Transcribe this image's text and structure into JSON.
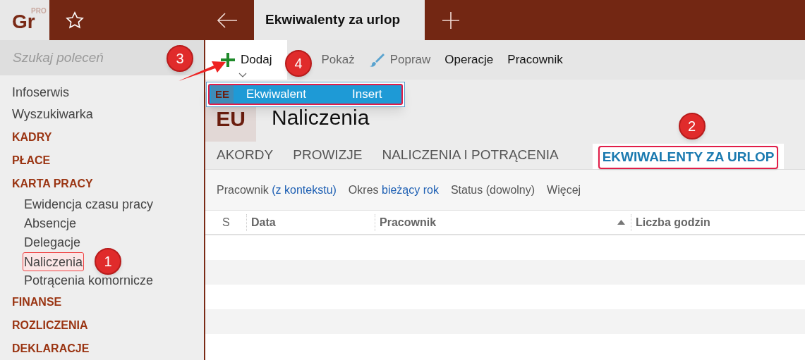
{
  "logo": {
    "text": "Gr",
    "badge": "PRO"
  },
  "search": {
    "placeholder": "Szukaj poleceń"
  },
  "document_tab": {
    "title": "Ekwiwalenty za urlop"
  },
  "toolbar": [
    {
      "label": "Dodaj",
      "kind": "plus",
      "disabled": false,
      "open": true,
      "marker": "3"
    },
    {
      "label": "Pokaż",
      "kind": "view",
      "disabled": true,
      "marker": "4"
    },
    {
      "label": "Popraw",
      "kind": "brush",
      "disabled": true
    },
    {
      "label": "Operacje",
      "disabled": false
    },
    {
      "label": "Pracownik",
      "disabled": false
    }
  ],
  "dropdown": [
    {
      "badge": "EE",
      "label": "Ekwiwalent",
      "shortcut": "Insert",
      "selected": true,
      "highlighted": true
    }
  ],
  "sidebar": {
    "items": [
      {
        "kind": "link",
        "label": "Infoserwis"
      },
      {
        "kind": "link",
        "label": "Wyszukiwarka"
      },
      {
        "kind": "section",
        "label": "KADRY"
      },
      {
        "kind": "section",
        "label": "PŁACE"
      },
      {
        "kind": "section",
        "label": "KARTA PRACY",
        "children": [
          {
            "label": "Ewidencja czasu pracy",
            "highlighted": false
          },
          {
            "label": "Absencje",
            "highlighted": false
          },
          {
            "label": "Delegacje",
            "highlighted": false
          },
          {
            "label": "Naliczenia",
            "highlighted": true,
            "marker": "1"
          },
          {
            "label": "Potrącenia komornicze",
            "highlighted": false
          }
        ]
      },
      {
        "kind": "section",
        "label": "FINANSE"
      },
      {
        "kind": "section",
        "label": "ROZLICZENIA"
      },
      {
        "kind": "section",
        "label": "DEKLARACJE"
      }
    ]
  },
  "header": {
    "badge": "EU",
    "title": "Naliczenia"
  },
  "tabs": [
    {
      "label": "AKORDY",
      "selected": false
    },
    {
      "label": "PROWIZJE",
      "selected": false
    },
    {
      "label": "NALICZENIA I POTRĄCENIA",
      "selected": false
    },
    {
      "label": "EKWIWALENTY ZA URLOP",
      "selected": true,
      "marker": "2"
    }
  ],
  "filters": [
    {
      "label": "Pracownik",
      "value": "(z kontekstu)"
    },
    {
      "label": "Okres",
      "value": "bieżący rok"
    },
    {
      "label": "Status (dowolny)"
    },
    {
      "label": "Więcej"
    }
  ],
  "table": {
    "columns": [
      {
        "label": "S"
      },
      {
        "label": "Data"
      },
      {
        "label": "Pracownik",
        "sorted": true
      },
      {
        "label": "Liczba godzin"
      }
    ]
  }
}
